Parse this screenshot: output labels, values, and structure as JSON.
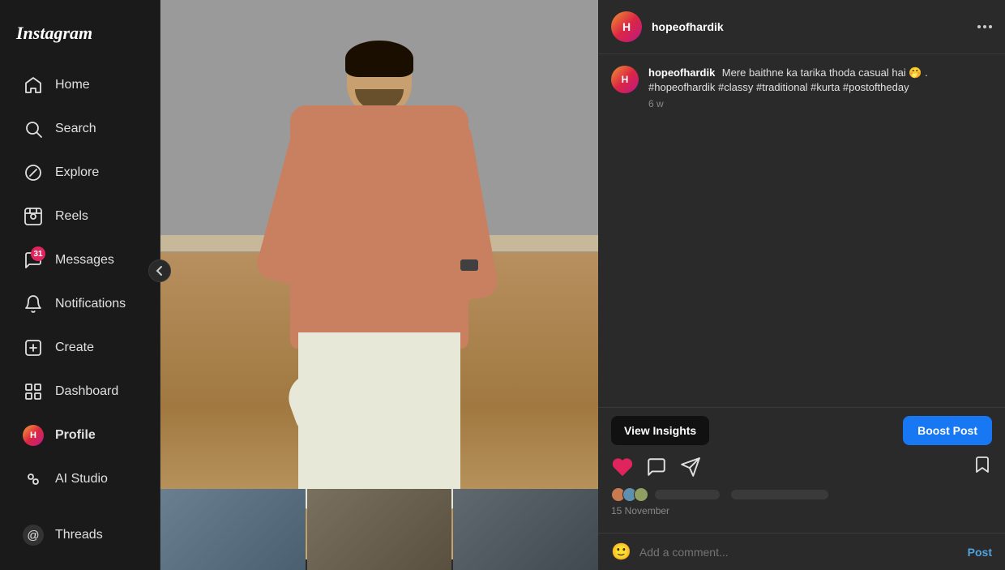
{
  "app": {
    "name": "Instagram"
  },
  "sidebar": {
    "logo": "Instagram",
    "items": [
      {
        "id": "home",
        "label": "Home",
        "icon": "home"
      },
      {
        "id": "search",
        "label": "Search",
        "icon": "search"
      },
      {
        "id": "explore",
        "label": "Explore",
        "icon": "explore"
      },
      {
        "id": "reels",
        "label": "Reels",
        "icon": "reels"
      },
      {
        "id": "messages",
        "label": "Messages",
        "icon": "messages",
        "badge": "31"
      },
      {
        "id": "notifications",
        "label": "Notifications",
        "icon": "notifications"
      },
      {
        "id": "create",
        "label": "Create",
        "icon": "create"
      },
      {
        "id": "dashboard",
        "label": "Dashboard",
        "icon": "dashboard"
      },
      {
        "id": "profile",
        "label": "Profile",
        "icon": "profile",
        "bold": true
      },
      {
        "id": "ai-studio",
        "label": "AI Studio",
        "icon": "ai-studio"
      },
      {
        "id": "threads",
        "label": "Threads",
        "icon": "threads"
      }
    ]
  },
  "post": {
    "username": "hopeofhardik",
    "header_username": "hopeofhardik",
    "caption_username": "hopeofhardik",
    "caption": "Mere baithne ka tarika thoda casual hai 🤭\n.\n#hopeofhardik #classy #traditional #kurta #postoftheday",
    "time_ago": "6 w",
    "date": "15 November",
    "view_insights": "View Insights",
    "boost_post": "Boost Post",
    "add_comment_placeholder": "Add a comment...",
    "post_label": "Post"
  }
}
